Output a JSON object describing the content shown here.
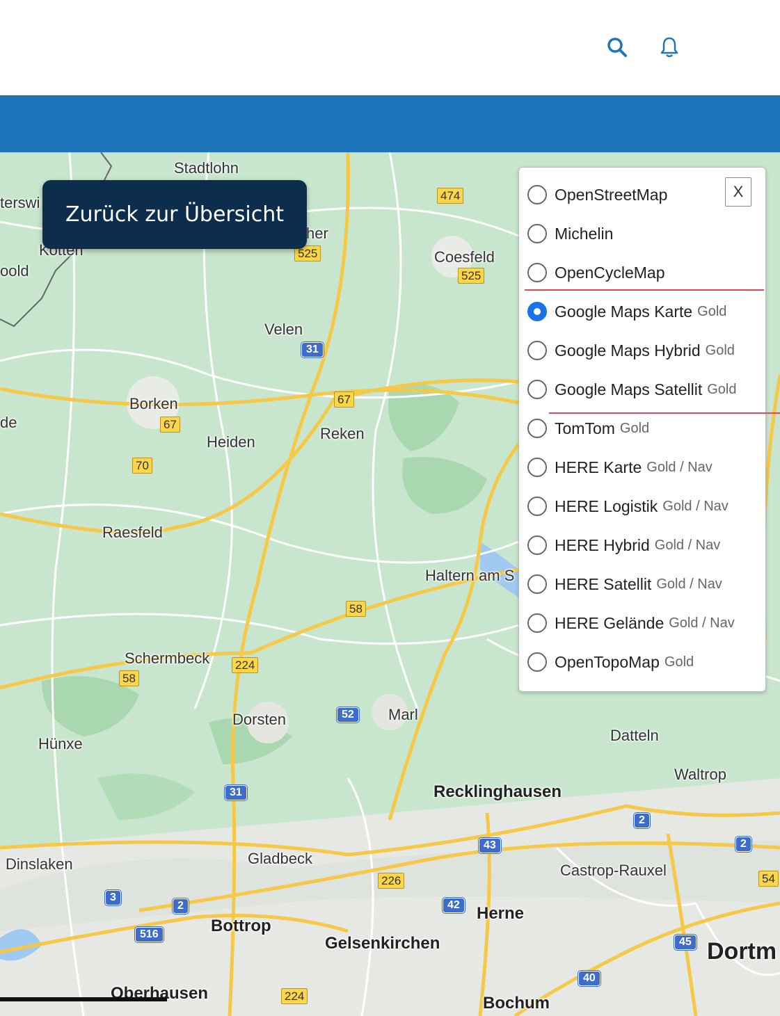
{
  "header": {
    "search_icon": "search-icon",
    "bell_icon": "bell-icon"
  },
  "back_button": {
    "label": "Zurück zur Übersicht"
  },
  "layer_panel": {
    "close_label": "X",
    "options": [
      {
        "label": "OpenStreetMap",
        "tier": "",
        "checked": false
      },
      {
        "label": "Michelin",
        "tier": "",
        "checked": false
      },
      {
        "label": "OpenCycleMap",
        "tier": "",
        "checked": false
      },
      {
        "label": "Google Maps Karte",
        "tier": "Gold",
        "checked": true
      },
      {
        "label": "Google Maps Hybrid",
        "tier": "Gold",
        "checked": false
      },
      {
        "label": "Google Maps Satellit",
        "tier": "Gold",
        "checked": false
      },
      {
        "label": "TomTom",
        "tier": "Gold",
        "checked": false
      },
      {
        "label": "HERE Karte",
        "tier": "Gold / Nav",
        "checked": false
      },
      {
        "label": "HERE Logistik",
        "tier": "Gold / Nav",
        "checked": false
      },
      {
        "label": "HERE Hybrid",
        "tier": "Gold / Nav",
        "checked": false
      },
      {
        "label": "HERE Satellit",
        "tier": "Gold / Nav",
        "checked": false
      },
      {
        "label": "HERE Gelände",
        "tier": "Gold / Nav",
        "checked": false
      },
      {
        "label": "OpenTopoMap",
        "tier": "Gold",
        "checked": false
      }
    ]
  },
  "map": {
    "places": {
      "stadtlohn": "Stadtlohn",
      "terswi": "terswi",
      "kotten": "Kotten",
      "oold": "oold",
      "her": "her",
      "coesfeld": "Coesfeld",
      "velen": "Velen",
      "borken": "Borken",
      "de": "de",
      "heiden": "Heiden",
      "reken": "Reken",
      "raesfeld": "Raesfeld",
      "haltern": "Haltern am S",
      "schermbeck": "Schermbeck",
      "dorsten": "Dorsten",
      "marl": "Marl",
      "huenxe": "Hünxe",
      "datteln": "Datteln",
      "waltrop": "Waltrop",
      "recklinghausen": "Recklinghausen",
      "gladbeck": "Gladbeck",
      "dinslaken": "Dinslaken",
      "castrop": "Castrop-Rauxel",
      "herne": "Herne",
      "bottrop": "Bottrop",
      "gelsenkirchen": "Gelsenkirchen",
      "dortm": "Dortm",
      "oberhausen": "Oberhausen",
      "bochum": "Bochum"
    },
    "shields": {
      "s474": "474",
      "s525a": "525",
      "s525b": "525",
      "s31a": "31",
      "s67a": "67",
      "s67b": "67",
      "s70": "70",
      "s58a": "58",
      "s224a": "224",
      "s58b": "58",
      "s52": "52",
      "s31b": "31",
      "s2a": "2",
      "s2b": "2",
      "s43": "43",
      "s226": "226",
      "s42": "42",
      "s54": "54",
      "s3": "3",
      "s2c": "2",
      "s516": "516",
      "s45": "45",
      "s40": "40",
      "s224b": "224"
    }
  }
}
